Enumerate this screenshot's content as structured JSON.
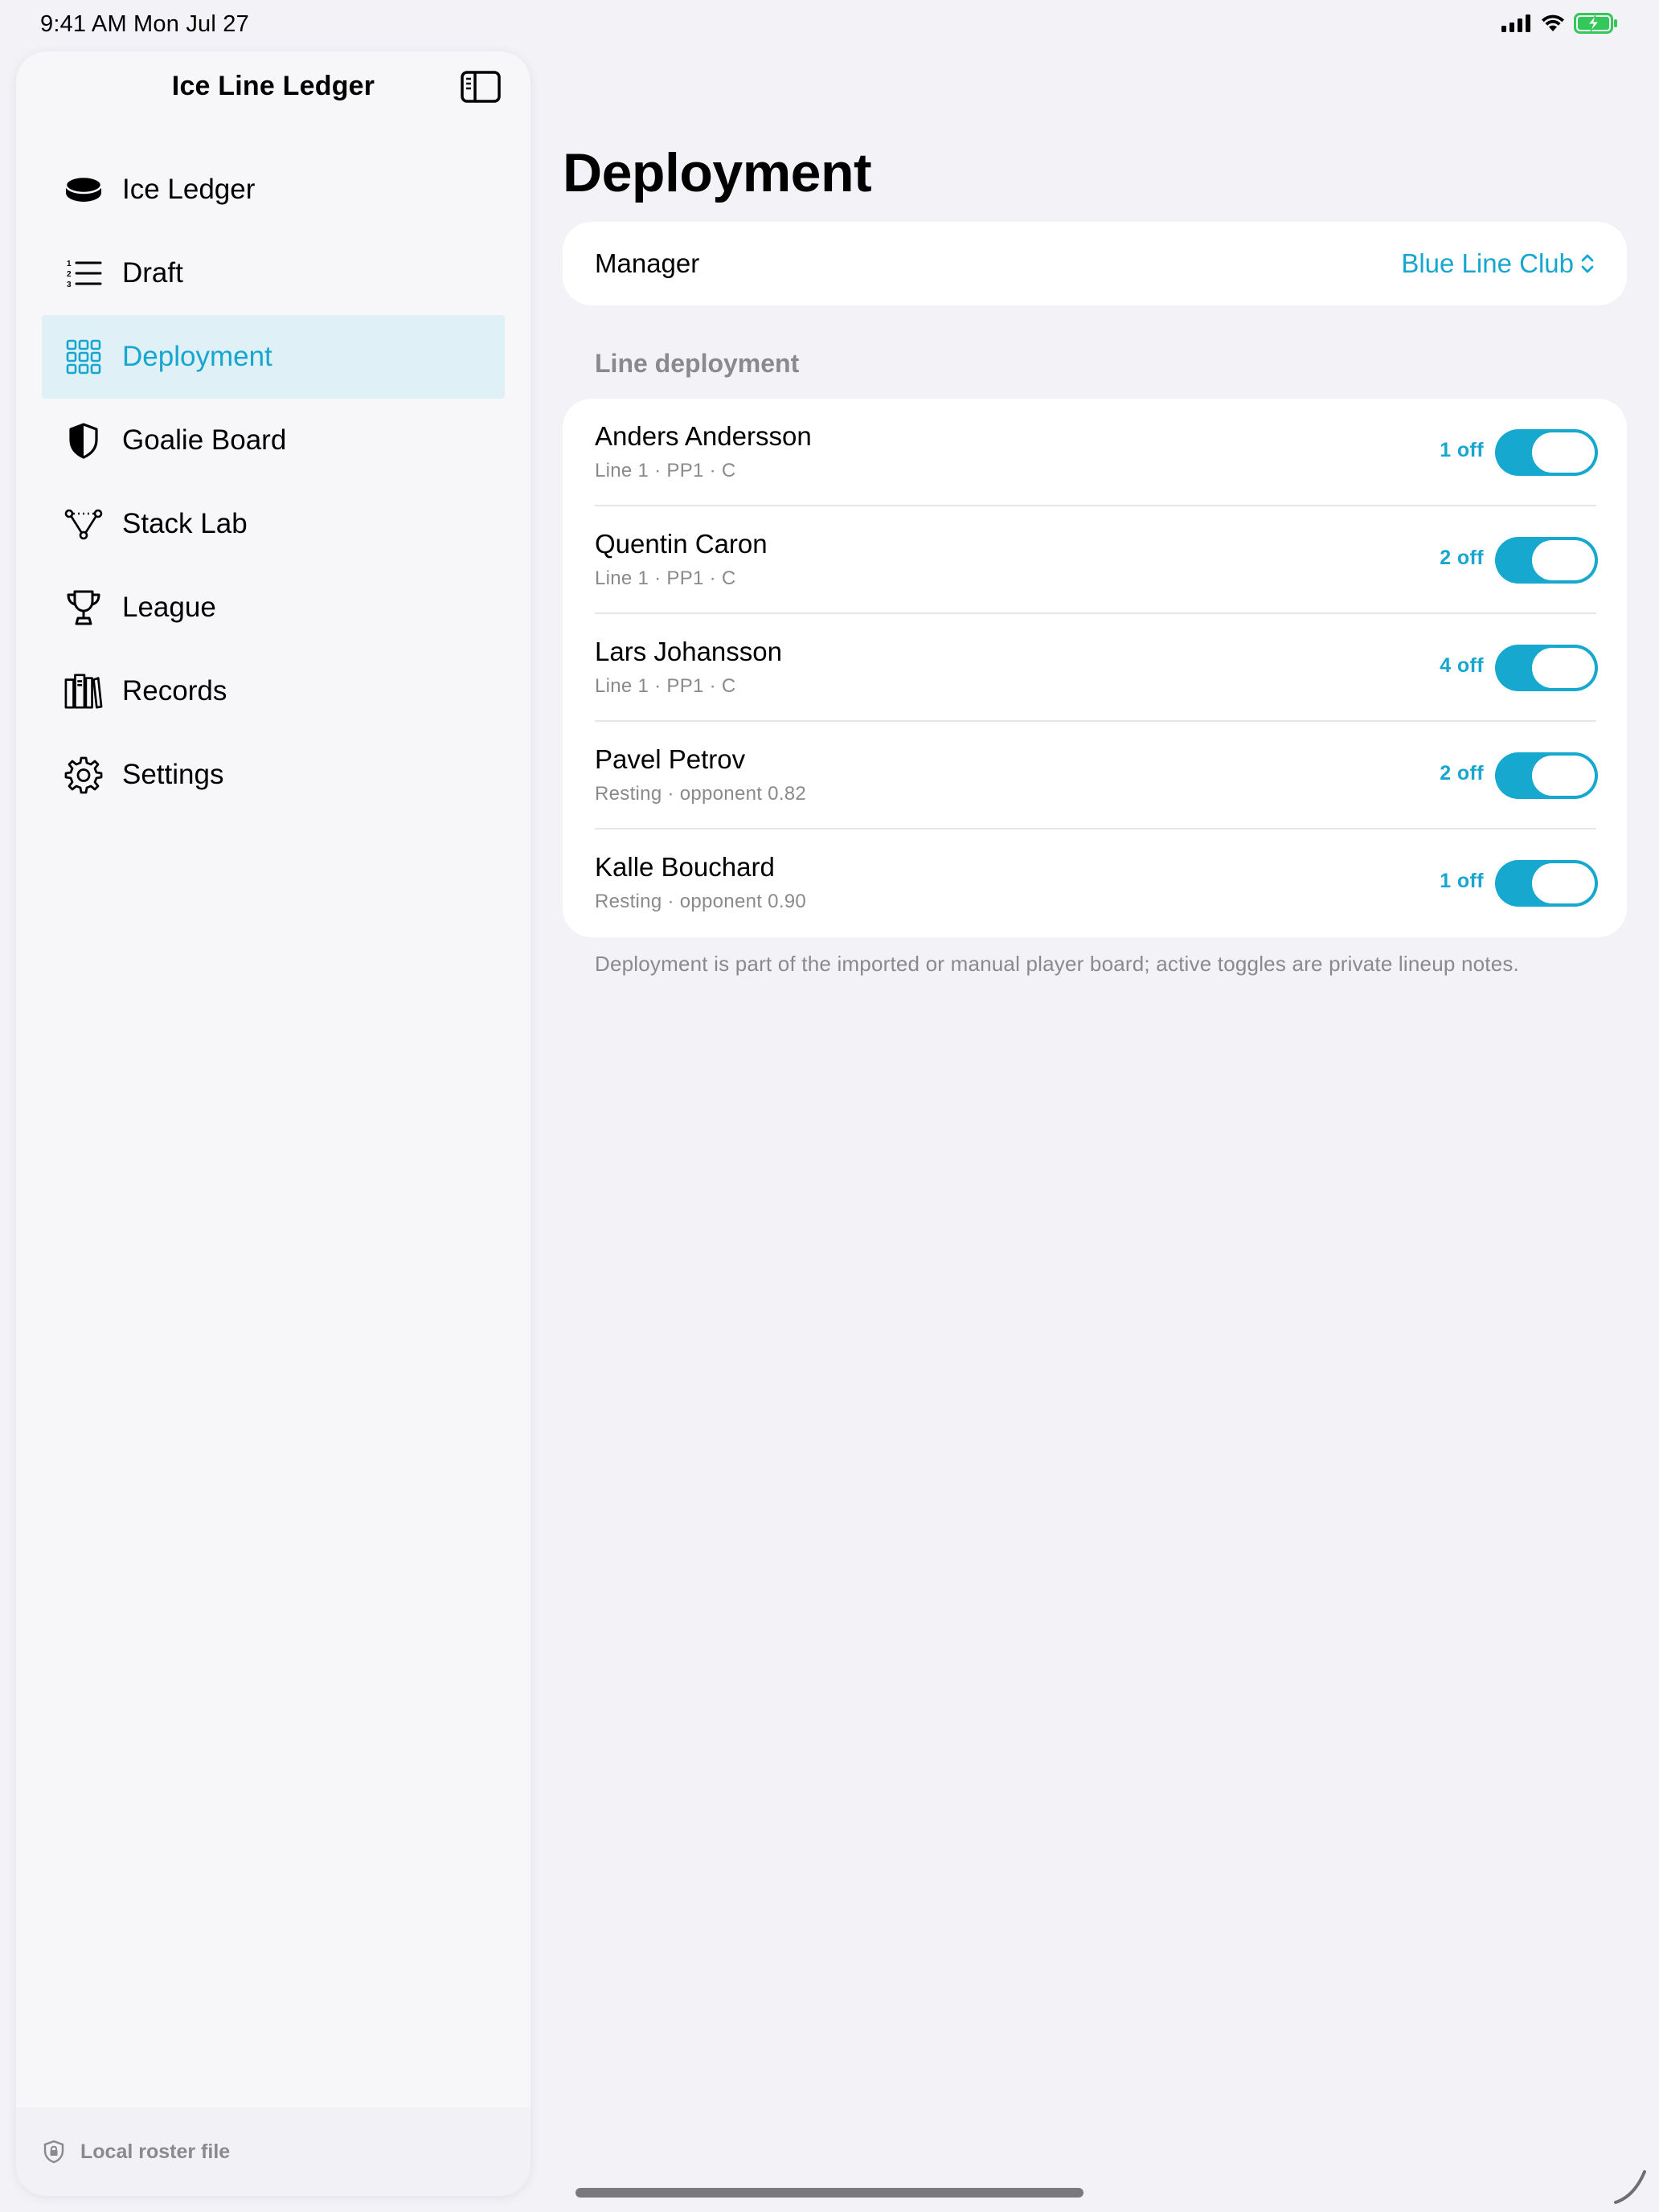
{
  "status_bar": {
    "time": "9:41 AM   Mon Jul 27",
    "colors": {
      "battery": "#34c759"
    },
    "icons": [
      "cellular-signal-icon",
      "wifi-icon",
      "battery-charging-icon"
    ]
  },
  "sidebar": {
    "title": "Ice Line Ledger",
    "toggle_icon": "sidebar-toggle-icon",
    "items": [
      {
        "label": "Ice Ledger",
        "icon": "hockey-puck-icon",
        "selected": false
      },
      {
        "label": "Draft",
        "icon": "numbered-list-icon",
        "selected": false
      },
      {
        "label": "Deployment",
        "icon": "grid-icon",
        "selected": true
      },
      {
        "label": "Goalie Board",
        "icon": "shield-icon",
        "selected": false
      },
      {
        "label": "Stack Lab",
        "icon": "nodes-icon",
        "selected": false
      },
      {
        "label": "League",
        "icon": "trophy-icon",
        "selected": false
      },
      {
        "label": "Records",
        "icon": "books-icon",
        "selected": false
      },
      {
        "label": "Settings",
        "icon": "gear-icon",
        "selected": false
      }
    ],
    "footer": {
      "label": "Local roster file",
      "icon": "lock-shield-icon"
    }
  },
  "main": {
    "title": "Deployment",
    "manager": {
      "label": "Manager",
      "value": "Blue Line Club"
    },
    "section_header": "Line deployment",
    "rows": [
      {
        "name": "Anders Andersson",
        "sub": "Line 1 · PP1 · C",
        "count": "1 off",
        "on": true
      },
      {
        "name": "Quentin Caron",
        "sub": "Line 1 · PP1 · C",
        "count": "2 off",
        "on": true
      },
      {
        "name": "Lars Johansson",
        "sub": "Line 1 · PP1 · C",
        "count": "4 off",
        "on": true
      },
      {
        "name": "Pavel Petrov",
        "sub": "Resting · opponent 0.82",
        "count": "2 off",
        "on": true
      },
      {
        "name": "Kalle Bouchard",
        "sub": "Resting · opponent 0.90",
        "count": "1 off",
        "on": true
      }
    ],
    "footnote": "Deployment is part of the imported or manual player board; active toggles are private lineup notes."
  },
  "colors": {
    "accent": "#17a6cf",
    "toggle_on": "#16a8cf",
    "selected_row": "#dff0f7",
    "background": "#f2f2f7",
    "secondary_text": "#8a8a8e"
  }
}
